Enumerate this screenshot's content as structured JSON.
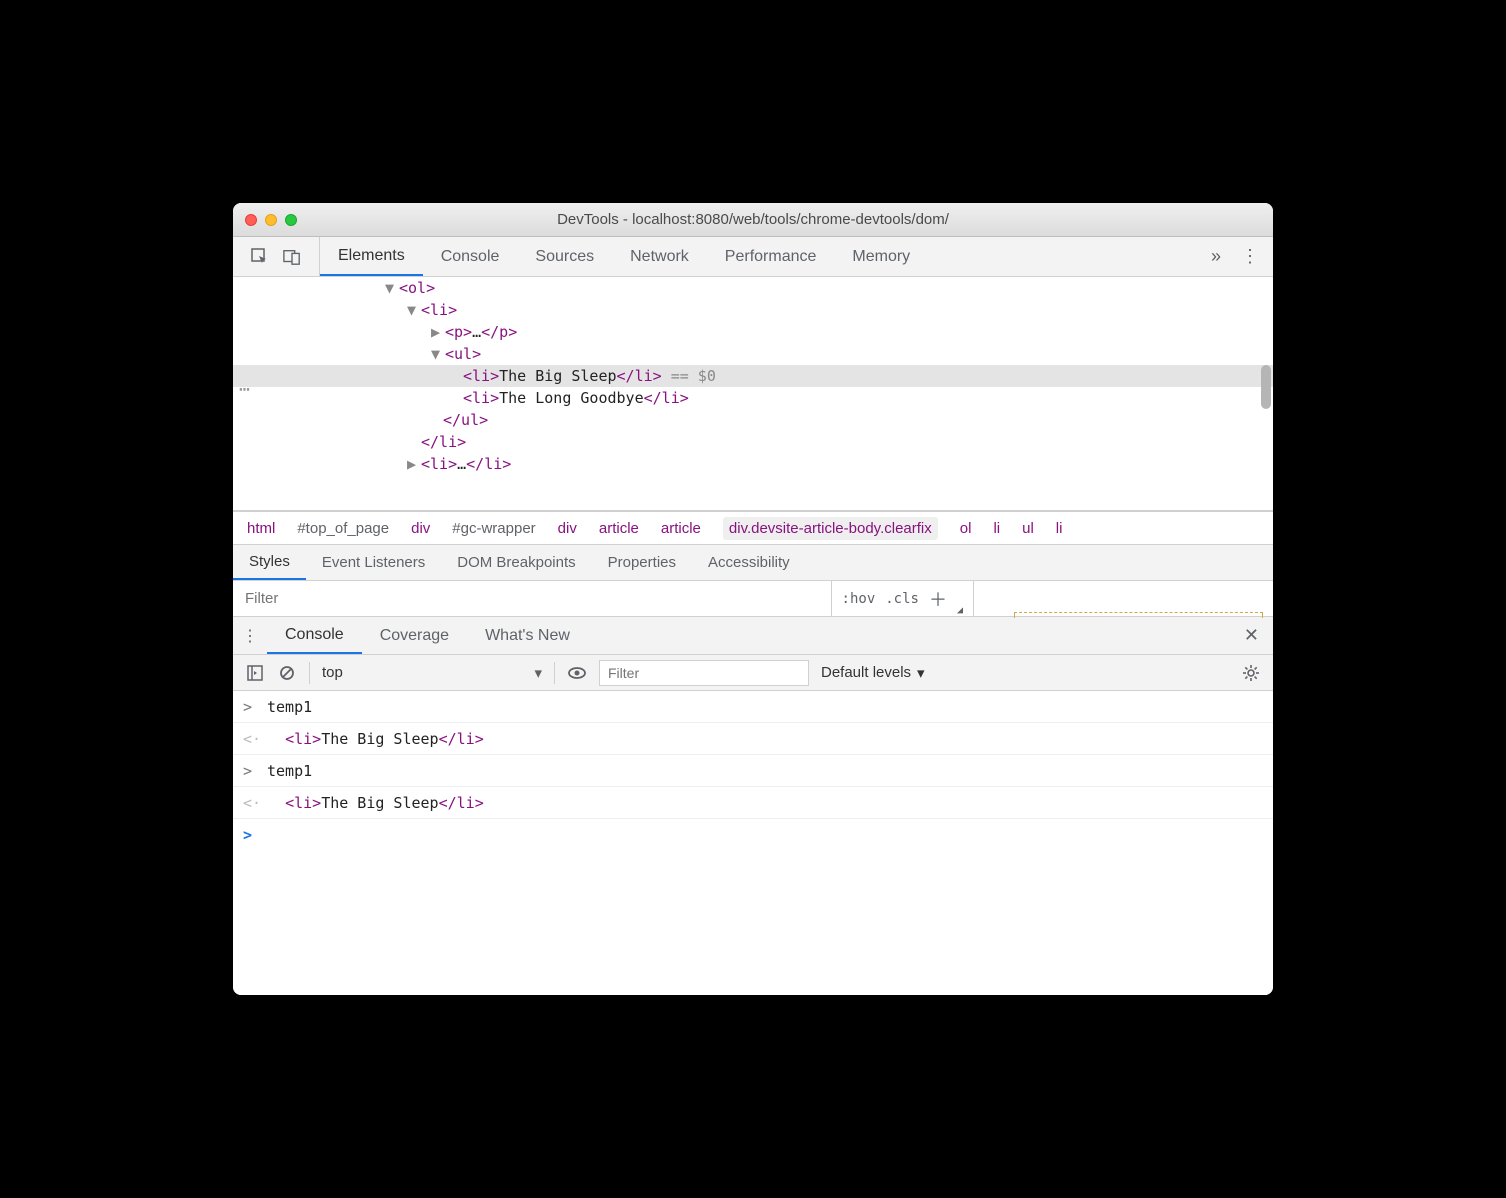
{
  "window": {
    "title": "DevTools - localhost:8080/web/tools/chrome-devtools/dom/"
  },
  "mainTabs": [
    "Elements",
    "Console",
    "Sources",
    "Network",
    "Performance",
    "Memory"
  ],
  "mainTabActive": "Elements",
  "domLines": [
    {
      "indent": 152,
      "tri": "▼",
      "tag_open": "<ol>",
      "text": "",
      "tag_close": "",
      "selected": false
    },
    {
      "indent": 174,
      "tri": "▼",
      "tag_open": "<li>",
      "text": "",
      "tag_close": "",
      "selected": false
    },
    {
      "indent": 198,
      "tri": "▶",
      "tag_open": "<p>",
      "text": "…",
      "tag_close": "</p>",
      "selected": false
    },
    {
      "indent": 198,
      "tri": "▼",
      "tag_open": "<ul>",
      "text": "",
      "tag_close": "",
      "selected": false
    },
    {
      "indent": 230,
      "tri": "",
      "tag_open": "<li>",
      "text": "The Big Sleep",
      "tag_close": "</li>",
      "suffix": " == $0",
      "selected": true
    },
    {
      "indent": 230,
      "tri": "",
      "tag_open": "<li>",
      "text": "The Long Goodbye",
      "tag_close": "</li>",
      "selected": false
    },
    {
      "indent": 210,
      "tri": "",
      "tag_raw": "</ul>",
      "selected": false
    },
    {
      "indent": 188,
      "tri": "",
      "tag_raw": "</li>",
      "selected": false
    },
    {
      "indent": 174,
      "tri": "▶",
      "tag_open": "<li>",
      "text": "…",
      "tag_close": "</li>",
      "selected": false
    }
  ],
  "breadcrumb": [
    {
      "text": "html",
      "class": "bc"
    },
    {
      "text": "#top_of_page",
      "class": "bc gray"
    },
    {
      "text": "div",
      "class": "bc"
    },
    {
      "text": "#gc-wrapper",
      "class": "bc gray"
    },
    {
      "text": "div",
      "class": "bc"
    },
    {
      "text": "article",
      "class": "bc"
    },
    {
      "text": "article",
      "class": "bc"
    },
    {
      "text": "div.devsite-article-body.clearfix",
      "class": "bc hl"
    },
    {
      "text": "ol",
      "class": "bc"
    },
    {
      "text": "li",
      "class": "bc"
    },
    {
      "text": "ul",
      "class": "bc"
    },
    {
      "text": "li",
      "class": "bc"
    }
  ],
  "subTabs": [
    "Styles",
    "Event Listeners",
    "DOM Breakpoints",
    "Properties",
    "Accessibility"
  ],
  "subTabActive": "Styles",
  "filterPlaceholder": "Filter",
  "filterSeg": {
    "hov": ":hov",
    "cls": ".cls"
  },
  "drawerTabs": [
    "Console",
    "Coverage",
    "What's New"
  ],
  "drawerTabActive": "Console",
  "consoleToolbar": {
    "context": "top",
    "filterPlaceholder": "Filter",
    "levels": "Default levels"
  },
  "consoleRows": [
    {
      "arrow": ">",
      "kind": "in",
      "text": "temp1"
    },
    {
      "arrow": "<·",
      "kind": "ret",
      "tag_open": "<li>",
      "text": "The Big Sleep",
      "tag_close": "</li>"
    },
    {
      "arrow": ">",
      "kind": "in",
      "text": "temp1"
    },
    {
      "arrow": "<·",
      "kind": "ret",
      "tag_open": "<li>",
      "text": "The Big Sleep",
      "tag_close": "</li>"
    }
  ]
}
